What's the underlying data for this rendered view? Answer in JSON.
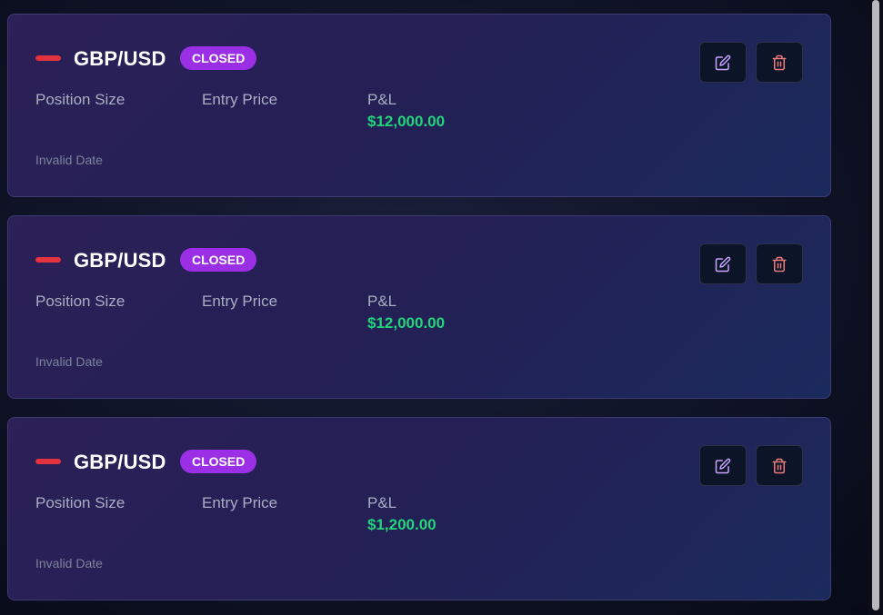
{
  "trades": [
    {
      "pair": "GBP/USD",
      "status": "CLOSED",
      "position_size_label": "Position Size",
      "entry_price_label": "Entry Price",
      "pl_label": "P&L",
      "pl_value": "$12,000.00",
      "date": "Invalid Date"
    },
    {
      "pair": "GBP/USD",
      "status": "CLOSED",
      "position_size_label": "Position Size",
      "entry_price_label": "Entry Price",
      "pl_label": "P&L",
      "pl_value": "$12,000.00",
      "date": "Invalid Date"
    },
    {
      "pair": "GBP/USD",
      "status": "CLOSED",
      "position_size_label": "Position Size",
      "entry_price_label": "Entry Price",
      "pl_label": "P&L",
      "pl_value": "$1,200.00",
      "date": "Invalid Date"
    }
  ],
  "icons": {
    "direction": "minus-icon",
    "edit": "edit-icon",
    "delete": "trash-icon"
  },
  "colors": {
    "direction_marker": "#e5323f",
    "status_badge": "#9b2fe6",
    "pl_positive": "#22d47b",
    "edit_icon": "#c9a3ff",
    "delete_icon": "#f07a7a"
  }
}
